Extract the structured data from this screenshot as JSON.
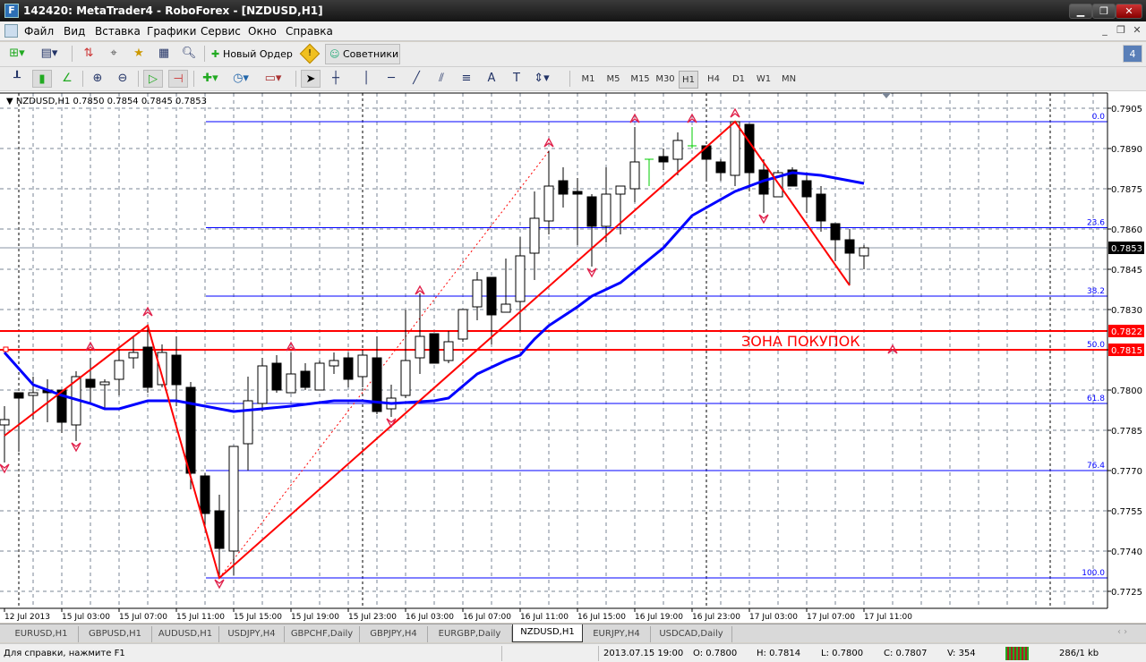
{
  "window": {
    "title": "142420: MetaTrader4 - RoboForex - [NZDUSD,H1]",
    "logo": "F"
  },
  "menu": [
    "Файл",
    "Вид",
    "Вставка",
    "Графики",
    "Сервис",
    "Окно",
    "Справка"
  ],
  "toolbar": {
    "new_order": "Новый Ордер",
    "experts": "Советники",
    "badge": "4"
  },
  "timeframes": {
    "items": [
      "M1",
      "M5",
      "M15",
      "M30",
      "H1",
      "H4",
      "D1",
      "W1",
      "MN"
    ],
    "active": "H1"
  },
  "chart": {
    "header": "NZDUSD,H1  0.7850 0.7854 0.7845 0.7853",
    "annotation": "ЗОНА ПОКУПОК",
    "colors": {
      "zigzag": "#ff0000",
      "ma": "#0000ff",
      "fib": "#0000ff",
      "grid": "#7a8596",
      "bull": "#ffffff",
      "bear": "#000000",
      "doji": "#00cc00"
    }
  },
  "chart_data": {
    "type": "candlestick",
    "symbol": "NZDUSD",
    "timeframe": "H1",
    "ylim": [
      0.772,
      0.791
    ],
    "y_ticks": [
      "0.7905",
      "0.7890",
      "0.7875",
      "0.7860",
      "0.7845",
      "0.7830",
      "0.7815",
      "0.7800",
      "0.7785",
      "0.7770",
      "0.7755",
      "0.7740",
      "0.7725"
    ],
    "x_ticks": [
      "12 Jul 2013",
      "15 Jul 03:00",
      "15 Jul 07:00",
      "15 Jul 11:00",
      "15 Jul 15:00",
      "15 Jul 19:00",
      "15 Jul 23:00",
      "16 Jul 03:00",
      "16 Jul 07:00",
      "16 Jul 11:00",
      "16 Jul 15:00",
      "16 Jul 19:00",
      "16 Jul 23:00",
      "17 Jul 03:00",
      "17 Jul 07:00",
      "17 Jul 11:00"
    ],
    "x_tick_every": 4,
    "candles_ohlc": [
      [
        0.7787,
        0.7794,
        0.7773,
        0.7789
      ],
      [
        0.7799,
        0.7799,
        0.7777,
        0.7797
      ],
      [
        0.7798,
        0.7805,
        0.7789,
        0.7799
      ],
      [
        0.78,
        0.7804,
        0.7788,
        0.7799
      ],
      [
        0.78,
        0.78,
        0.7784,
        0.7788
      ],
      [
        0.7787,
        0.7807,
        0.7781,
        0.7805
      ],
      [
        0.7804,
        0.7812,
        0.7795,
        0.7801
      ],
      [
        0.7802,
        0.7804,
        0.7793,
        0.7803
      ],
      [
        0.7804,
        0.7815,
        0.7798,
        0.7811
      ],
      [
        0.7812,
        0.782,
        0.7808,
        0.7814
      ],
      [
        0.7816,
        0.7824,
        0.7799,
        0.7801
      ],
      [
        0.7802,
        0.7817,
        0.7801,
        0.7814
      ],
      [
        0.7813,
        0.782,
        0.7794,
        0.7802
      ],
      [
        0.7801,
        0.7803,
        0.7763,
        0.7769
      ],
      [
        0.7768,
        0.7769,
        0.7749,
        0.7754
      ],
      [
        0.7755,
        0.7761,
        0.773,
        0.7741
      ],
      [
        0.774,
        0.7779,
        0.7731,
        0.7779
      ],
      [
        0.778,
        0.7805,
        0.777,
        0.7796
      ],
      [
        0.7795,
        0.7812,
        0.7792,
        0.7809
      ],
      [
        0.781,
        0.7813,
        0.7799,
        0.78
      ],
      [
        0.7799,
        0.7814,
        0.7799,
        0.7806
      ],
      [
        0.7807,
        0.781,
        0.78,
        0.7801
      ],
      [
        0.78,
        0.7811,
        0.78,
        0.781
      ],
      [
        0.7809,
        0.7814,
        0.7806,
        0.7811
      ],
      [
        0.7812,
        0.7814,
        0.7801,
        0.7804
      ],
      [
        0.7805,
        0.7815,
        0.7801,
        0.7813
      ],
      [
        0.7812,
        0.782,
        0.7791,
        0.7792
      ],
      [
        0.7793,
        0.7802,
        0.779,
        0.7797
      ],
      [
        0.7798,
        0.783,
        0.7797,
        0.7811
      ],
      [
        0.7812,
        0.7836,
        0.7806,
        0.782
      ],
      [
        0.7821,
        0.7821,
        0.781,
        0.781
      ],
      [
        0.7811,
        0.7822,
        0.781,
        0.7818
      ],
      [
        0.7819,
        0.783,
        0.7818,
        0.783
      ],
      [
        0.7831,
        0.7844,
        0.7826,
        0.7841
      ],
      [
        0.7842,
        0.7842,
        0.7817,
        0.7828
      ],
      [
        0.7829,
        0.7849,
        0.7829,
        0.7832
      ],
      [
        0.7833,
        0.7857,
        0.7822,
        0.785
      ],
      [
        0.7851,
        0.7874,
        0.7841,
        0.7864
      ],
      [
        0.7863,
        0.7889,
        0.7858,
        0.7876
      ],
      [
        0.7878,
        0.7883,
        0.7868,
        0.7873
      ],
      [
        0.7874,
        0.7879,
        0.7854,
        0.7873
      ],
      [
        0.7872,
        0.7873,
        0.7846,
        0.7861
      ],
      [
        0.7861,
        0.7883,
        0.7855,
        0.7873
      ],
      [
        0.7873,
        0.7876,
        0.7858,
        0.7876
      ],
      [
        0.7875,
        0.7898,
        0.787,
        0.7885
      ],
      [
        0.7886,
        0.7886,
        0.7876,
        0.7886
      ],
      [
        0.7887,
        0.789,
        0.7882,
        0.7885
      ],
      [
        0.7886,
        0.7896,
        0.788,
        0.7893
      ],
      [
        0.7891,
        0.7898,
        0.789,
        0.7891
      ],
      [
        0.7891,
        0.7891,
        0.7878,
        0.7886
      ],
      [
        0.7885,
        0.7886,
        0.7878,
        0.7881
      ],
      [
        0.788,
        0.79,
        0.7876,
        0.79
      ],
      [
        0.7899,
        0.7899,
        0.7874,
        0.7881
      ],
      [
        0.7882,
        0.7886,
        0.7866,
        0.7873
      ],
      [
        0.7872,
        0.7882,
        0.7872,
        0.7881
      ],
      [
        0.7882,
        0.7883,
        0.7876,
        0.7876
      ],
      [
        0.7878,
        0.788,
        0.7866,
        0.7872
      ],
      [
        0.7873,
        0.7876,
        0.7859,
        0.7863
      ],
      [
        0.7862,
        0.7862,
        0.7848,
        0.7856
      ],
      [
        0.7856,
        0.786,
        0.7839,
        0.7851
      ],
      [
        0.785,
        0.7854,
        0.7845,
        0.7853
      ]
    ],
    "doji_highlight": [
      45,
      48
    ],
    "moving_average": [
      [
        0,
        0.7814
      ],
      [
        2,
        0.7802
      ],
      [
        4,
        0.7798
      ],
      [
        6,
        0.7795
      ],
      [
        7,
        0.7793
      ],
      [
        8,
        0.7793
      ],
      [
        10,
        0.7796
      ],
      [
        12,
        0.7796
      ],
      [
        14,
        0.7794
      ],
      [
        16,
        0.7792
      ],
      [
        18,
        0.7793
      ],
      [
        20,
        0.7794
      ],
      [
        23,
        0.7796
      ],
      [
        25,
        0.7796
      ],
      [
        27,
        0.7795
      ],
      [
        30,
        0.7796
      ],
      [
        31,
        0.7797
      ],
      [
        33,
        0.7806
      ],
      [
        35,
        0.7811
      ],
      [
        36,
        0.7813
      ],
      [
        37,
        0.7819
      ],
      [
        38,
        0.7824
      ],
      [
        40,
        0.7831
      ],
      [
        41,
        0.7835
      ],
      [
        43,
        0.784
      ],
      [
        46,
        0.7853
      ],
      [
        48,
        0.7865
      ],
      [
        51,
        0.7874
      ],
      [
        53,
        0.7878
      ],
      [
        55,
        0.7881
      ],
      [
        57,
        0.788
      ],
      [
        60,
        0.7877
      ]
    ],
    "zigzag": [
      [
        0,
        0.7783
      ],
      [
        10,
        0.7824
      ],
      [
        15,
        0.773
      ],
      [
        51,
        0.79
      ],
      [
        59,
        0.7839
      ]
    ],
    "dotted_trend": [
      [
        15,
        0.773
      ],
      [
        38,
        0.7889
      ]
    ],
    "fractals_up": [
      [
        6,
        0.7816
      ],
      [
        10,
        0.7829
      ],
      [
        20,
        0.7816
      ],
      [
        29,
        0.7837
      ],
      [
        38,
        0.7892
      ],
      [
        44,
        0.7901
      ],
      [
        48,
        0.7901
      ],
      [
        51,
        0.7903
      ],
      [
        62,
        0.7815
      ]
    ],
    "fractals_down": [
      [
        0,
        0.7771
      ],
      [
        5,
        0.7779
      ],
      [
        15,
        0.7728
      ],
      [
        27,
        0.7788
      ],
      [
        41,
        0.7844
      ],
      [
        53,
        0.7864
      ]
    ],
    "fibonacci": {
      "start_index": 14,
      "levels": [
        {
          "label": "0.0",
          "price": 0.79
        },
        {
          "label": "23.6",
          "price": 0.78605
        },
        {
          "label": "38.2",
          "price": 0.7835
        },
        {
          "label": "50.0",
          "price": 0.7815
        },
        {
          "label": "61.8",
          "price": 0.7795
        },
        {
          "label": "76.4",
          "price": 0.777
        },
        {
          "label": "100.0",
          "price": 0.773
        }
      ]
    },
    "horizontal_lines": [
      {
        "price": 0.7822,
        "label": "0.7822"
      },
      {
        "price": 0.7815,
        "label": "0.7815"
      }
    ],
    "bid_line": {
      "price": 0.7853,
      "label": "0.7853"
    },
    "day_separators": [
      1,
      25,
      49,
      73
    ]
  },
  "tabs": {
    "items": [
      "EURUSD,H1",
      "GBPUSD,H1",
      "AUDUSD,H1",
      "USDJPY,H4",
      "GBPCHF,Daily",
      "GBPJPY,H4",
      "EURGBP,Daily",
      "NZDUSD,H1",
      "EURJPY,H4",
      "USDCAD,Daily"
    ],
    "active": "NZDUSD,H1"
  },
  "status": {
    "help": "Для справки, нажмите F1",
    "datetime": "2013.07.15 19:00",
    "open": "O: 0.7800",
    "high": "H: 0.7814",
    "low": "L: 0.7800",
    "close": "C: 0.7807",
    "volume": "V: 354",
    "traffic": "286/1 kb"
  }
}
